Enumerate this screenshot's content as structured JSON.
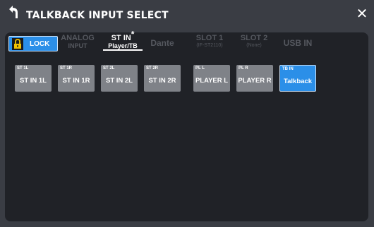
{
  "window": {
    "title": "TALKBACK INPUT SELECT"
  },
  "lock": {
    "label": "LOCK"
  },
  "tabs": [
    {
      "line1": "ANALOG",
      "line2": "INPUT"
    },
    {
      "line1": "ST IN",
      "line2": "Player/TB",
      "marker": "*"
    },
    {
      "line1": "Dante"
    },
    {
      "line1": "SLOT 1",
      "line2": "(IF-ST2110)"
    },
    {
      "line1": "SLOT 2",
      "line2": "(None)"
    },
    {
      "line1": "USB IN"
    }
  ],
  "sources": [
    {
      "sub": "ST 1L",
      "label": "ST IN 1L"
    },
    {
      "sub": "ST 1R",
      "label": "ST IN 1R"
    },
    {
      "sub": "ST 2L",
      "label": "ST IN 2L"
    },
    {
      "sub": "ST 2R",
      "label": "ST IN 2R"
    },
    {
      "sub": "PL L",
      "label": "PLAYER L"
    },
    {
      "sub": "PL R",
      "label": "PLAYER R"
    },
    {
      "sub": "TB IN",
      "label": "Talkback"
    }
  ],
  "colors": {
    "accent": "#2b8fe8",
    "button": "#7f8288",
    "panel": "#202227",
    "window": "#3a3d44"
  },
  "icons": {
    "back": "back-arrow-icon",
    "close": "close-icon",
    "lock": "padlock-icon"
  }
}
